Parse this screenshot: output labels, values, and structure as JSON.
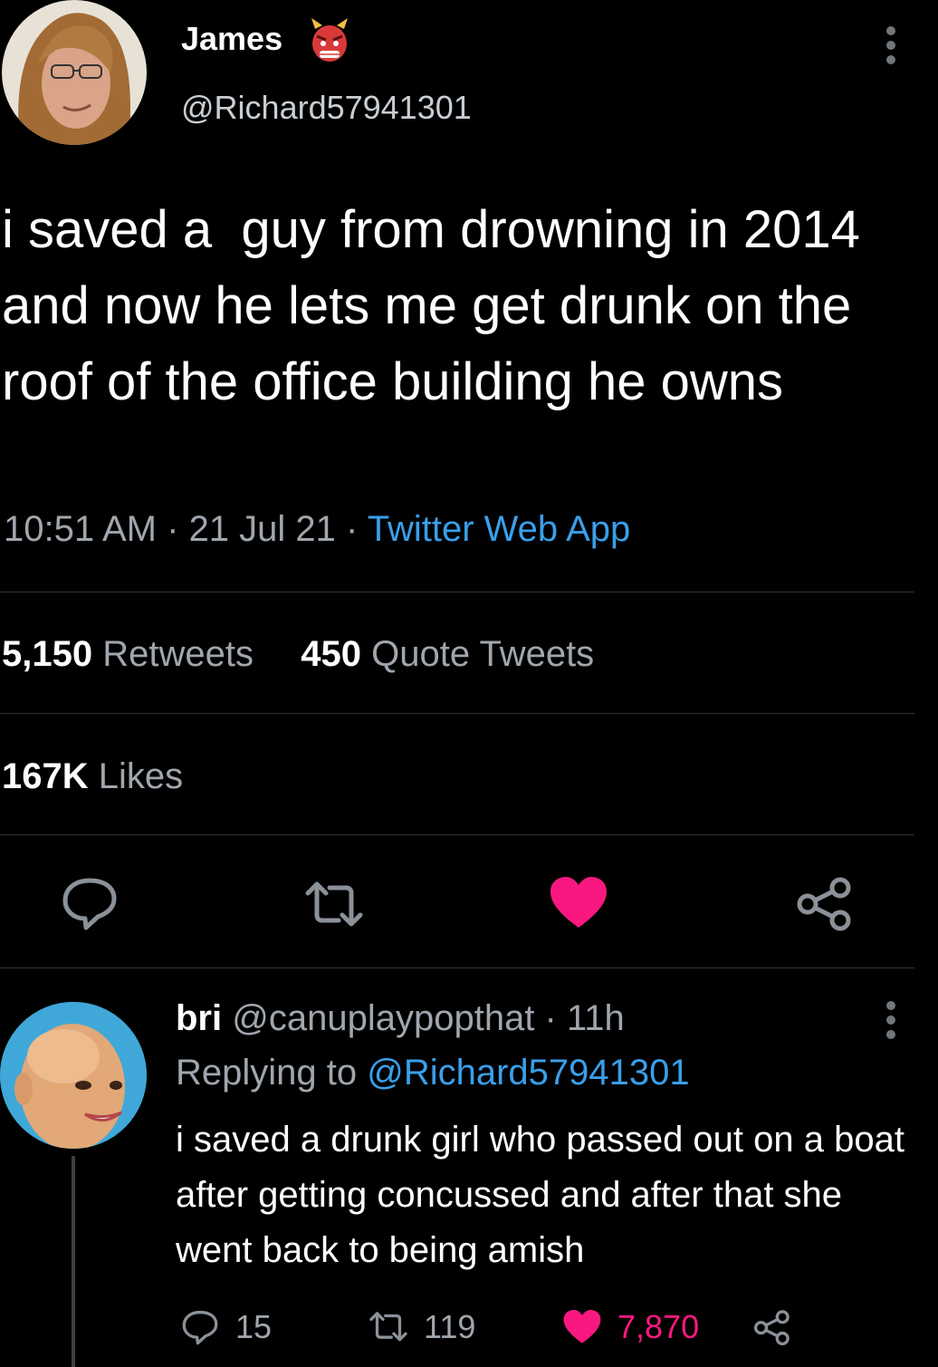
{
  "tweet": {
    "author_name": "James",
    "author_badge_icon": "ogre-emoji-icon",
    "handle": "@Richard57941301",
    "text": "i saved a  guy from drowning in 2014 and now he lets me get drunk on the roof of the office building he owns",
    "time": "10:51 AM",
    "date": "21 Jul 21",
    "source": "Twitter Web App",
    "separator": " · "
  },
  "stats": {
    "retweets_count": "5,150",
    "retweets_label": "Retweets",
    "quotes_count": "450",
    "quotes_label": "Quote Tweets",
    "likes_count": "167K",
    "likes_label": "Likes"
  },
  "reply": {
    "name": "bri",
    "handle": "@canuplaypopthat",
    "separator": " · ",
    "age": "11h",
    "replying_label": "Replying to ",
    "replying_to": "@Richard57941301",
    "text": "i saved a drunk girl who passed out on a boat after getting concussed and after that she went back to being amish",
    "reply_count": "15",
    "retweet_count": "119",
    "like_count": "7,870"
  },
  "colors": {
    "background": "#000000",
    "link_blue": "#3a9fea",
    "like_pink": "#f91880",
    "muted_text": "#a0a6ad"
  }
}
